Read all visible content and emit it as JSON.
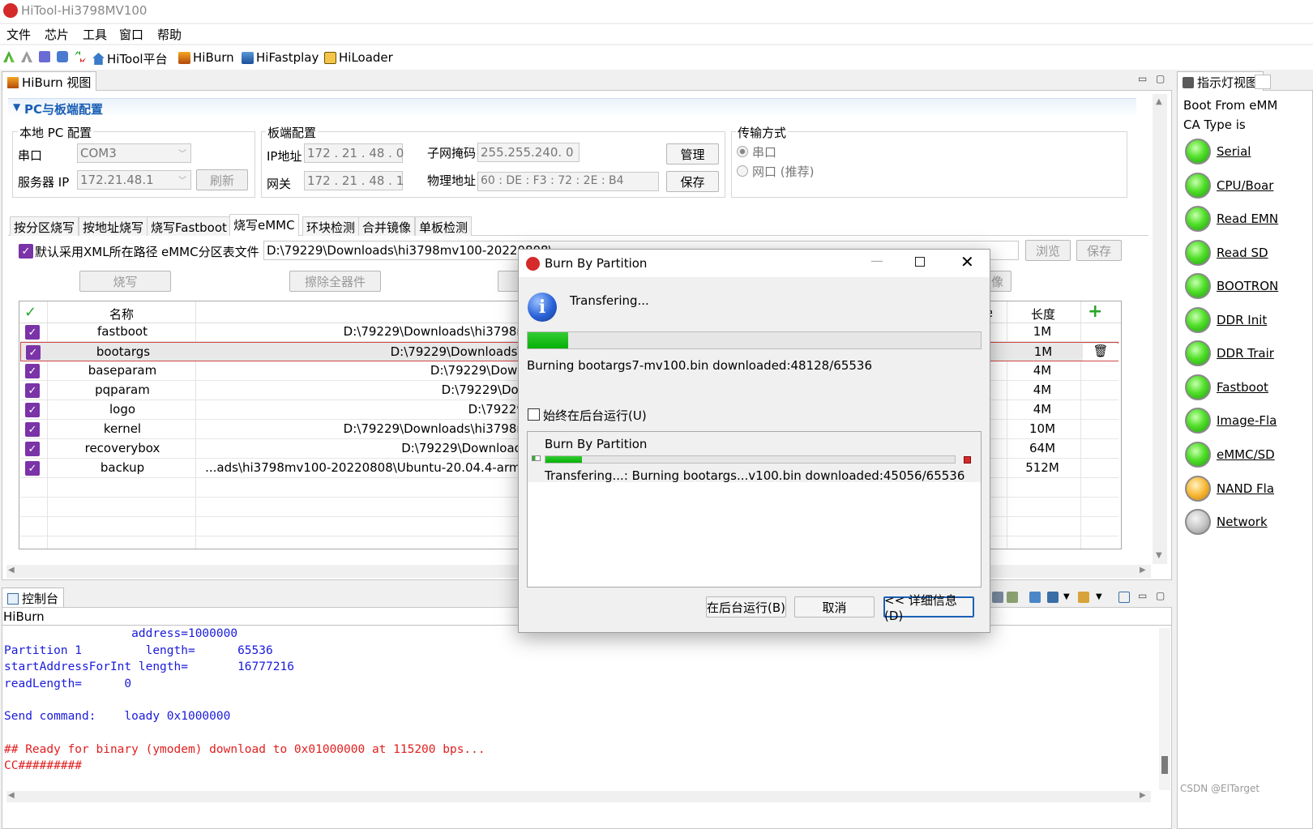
{
  "window": {
    "title": "HiTool-Hi3798MV100"
  },
  "menu": [
    "文件",
    "芯片",
    "工具",
    "窗口",
    "帮助"
  ],
  "toolbar": {
    "links": [
      "HiTool平台",
      "HiBurn",
      "HiFastplay",
      "HiLoader"
    ]
  },
  "views": {
    "hiburn_tab": "HiBurn 视图",
    "indicator_tab": "指示灯视图",
    "console_tab": "控制台"
  },
  "pc_config": {
    "section_title": "PC与板端配置",
    "local": {
      "title": "本地 PC 配置",
      "serial_label": "串口",
      "serial_value": "COM3",
      "server_ip_label": "服务器 IP",
      "server_ip_value": "172.21.48.1",
      "refresh": "刷新"
    },
    "board": {
      "title": "板端配置",
      "ip_label": "IP地址",
      "ip_value": "172 . 21 . 48 .  0",
      "gateway_label": "网关",
      "gateway_value": "172 . 21 . 48 .  1",
      "mask_label": "子网掩码",
      "mask_value": "255.255.240. 0",
      "mac_label": "物理地址",
      "mac_value": "60  :  DE  :  F3  :  72  :  2E  :  B4",
      "manage": "管理",
      "save": "保存"
    },
    "transfer": {
      "title": "传输方式",
      "serial": "串口",
      "net": "网口  (推荐)"
    }
  },
  "subtabs": [
    "按分区烧写",
    "按地址烧写",
    "烧写Fastboot",
    "烧写eMMC",
    "环块检测",
    "合并镜像",
    "单板检测"
  ],
  "emmc": {
    "xml_default": "默认采用XML所在路径",
    "file_label": "eMMC分区表文件",
    "file_value": "D:\\79229\\Downloads\\hi3798mv100-20220808\\",
    "browse": "浏览",
    "save": "保存",
    "burn": "烧写",
    "erase": "擦除全器件",
    "right_fragment": "像",
    "ver_fragment": "e"
  },
  "table": {
    "header_name": "名称",
    "header_length": "长度",
    "rows": [
      {
        "name": "fastboot",
        "path": "D:\\79229\\Downloads\\hi3798m",
        "length": "1M"
      },
      {
        "name": "bootargs",
        "path": "D:\\79229\\Downloads\\h",
        "length": "1M"
      },
      {
        "name": "baseparam",
        "path": "D:\\79229\\Downl",
        "length": "4M"
      },
      {
        "name": "pqparam",
        "path": "D:\\79229\\Dow",
        "length": "4M"
      },
      {
        "name": "logo",
        "path": "D:\\79229\\",
        "length": "4M"
      },
      {
        "name": "kernel",
        "path": "D:\\79229\\Downloads\\hi3798m",
        "length": "10M"
      },
      {
        "name": "recoverybox",
        "path": "D:\\79229\\Downloads",
        "length": "64M"
      },
      {
        "name": "backup",
        "path": "...ads\\hi3798mv100-20220808\\Ubuntu-20.04.4-armh",
        "length": "512M"
      }
    ]
  },
  "indicator": {
    "boot_from": "Boot From  eMM",
    "ca_type": "CA Type is",
    "leds": [
      {
        "label": "Serial",
        "state": "green"
      },
      {
        "label": "CPU/Boar",
        "state": "green"
      },
      {
        "label": "Read EMN",
        "state": "green"
      },
      {
        "label": "Read SD",
        "state": "green"
      },
      {
        "label": "BOOTRON",
        "state": "green"
      },
      {
        "label": "DDR Init",
        "state": "green"
      },
      {
        "label": "DDR Trair",
        "state": "green"
      },
      {
        "label": "Fastboot",
        "state": "green"
      },
      {
        "label": "Image-Fla",
        "state": "green"
      },
      {
        "label": "eMMC/SD",
        "state": "green"
      },
      {
        "label": "NAND Fla",
        "state": "orange"
      },
      {
        "label": "Network",
        "state": "gray"
      }
    ]
  },
  "console": {
    "name": "HiBurn",
    "lines": [
      {
        "text": "                  address=1000000",
        "color": "#1a1adb"
      },
      {
        "text": "Partition 1         length=      65536",
        "color": "#1a1adb"
      },
      {
        "text": "startAddressForInt length=       16777216",
        "color": "#1a1adb"
      },
      {
        "text": "readLength=      0",
        "color": "#1a1adb"
      },
      {
        "text": "",
        "color": "#1a1adb"
      },
      {
        "text": "Send command:    loady 0x1000000",
        "color": "#1a1adb"
      },
      {
        "text": "",
        "color": "#1a1adb"
      },
      {
        "text": "## Ready for binary (ymodem) download to 0x01000000 at 115200 bps...",
        "color": "#e02020"
      },
      {
        "text": "CC#########",
        "color": "#e02020"
      }
    ]
  },
  "dialog": {
    "title": "Burn By Partition",
    "heading": "Transfering...",
    "progress": 0.09,
    "status": "Burning bootargs7-mv100.bin downloaded:48128/65536",
    "background_checkbox": "始终在后台运行(U)",
    "detail_title": "Burn By Partition",
    "detail_progress": 0.09,
    "detail_status": "Transfering...:  Burning bootargs...v100.bin downloaded:45056/65536",
    "btn_background": "在后台运行(B)",
    "btn_cancel": "取消",
    "btn_details": "<< 详细信息(D)"
  },
  "watermark": "CSDN @ElTarget",
  "colors": {
    "accent_blue": "#1a5fb4",
    "check_purple": "#7b33a8",
    "progress_green": "#06b006",
    "error_red": "#e02020",
    "console_blue": "#1a1adb"
  }
}
